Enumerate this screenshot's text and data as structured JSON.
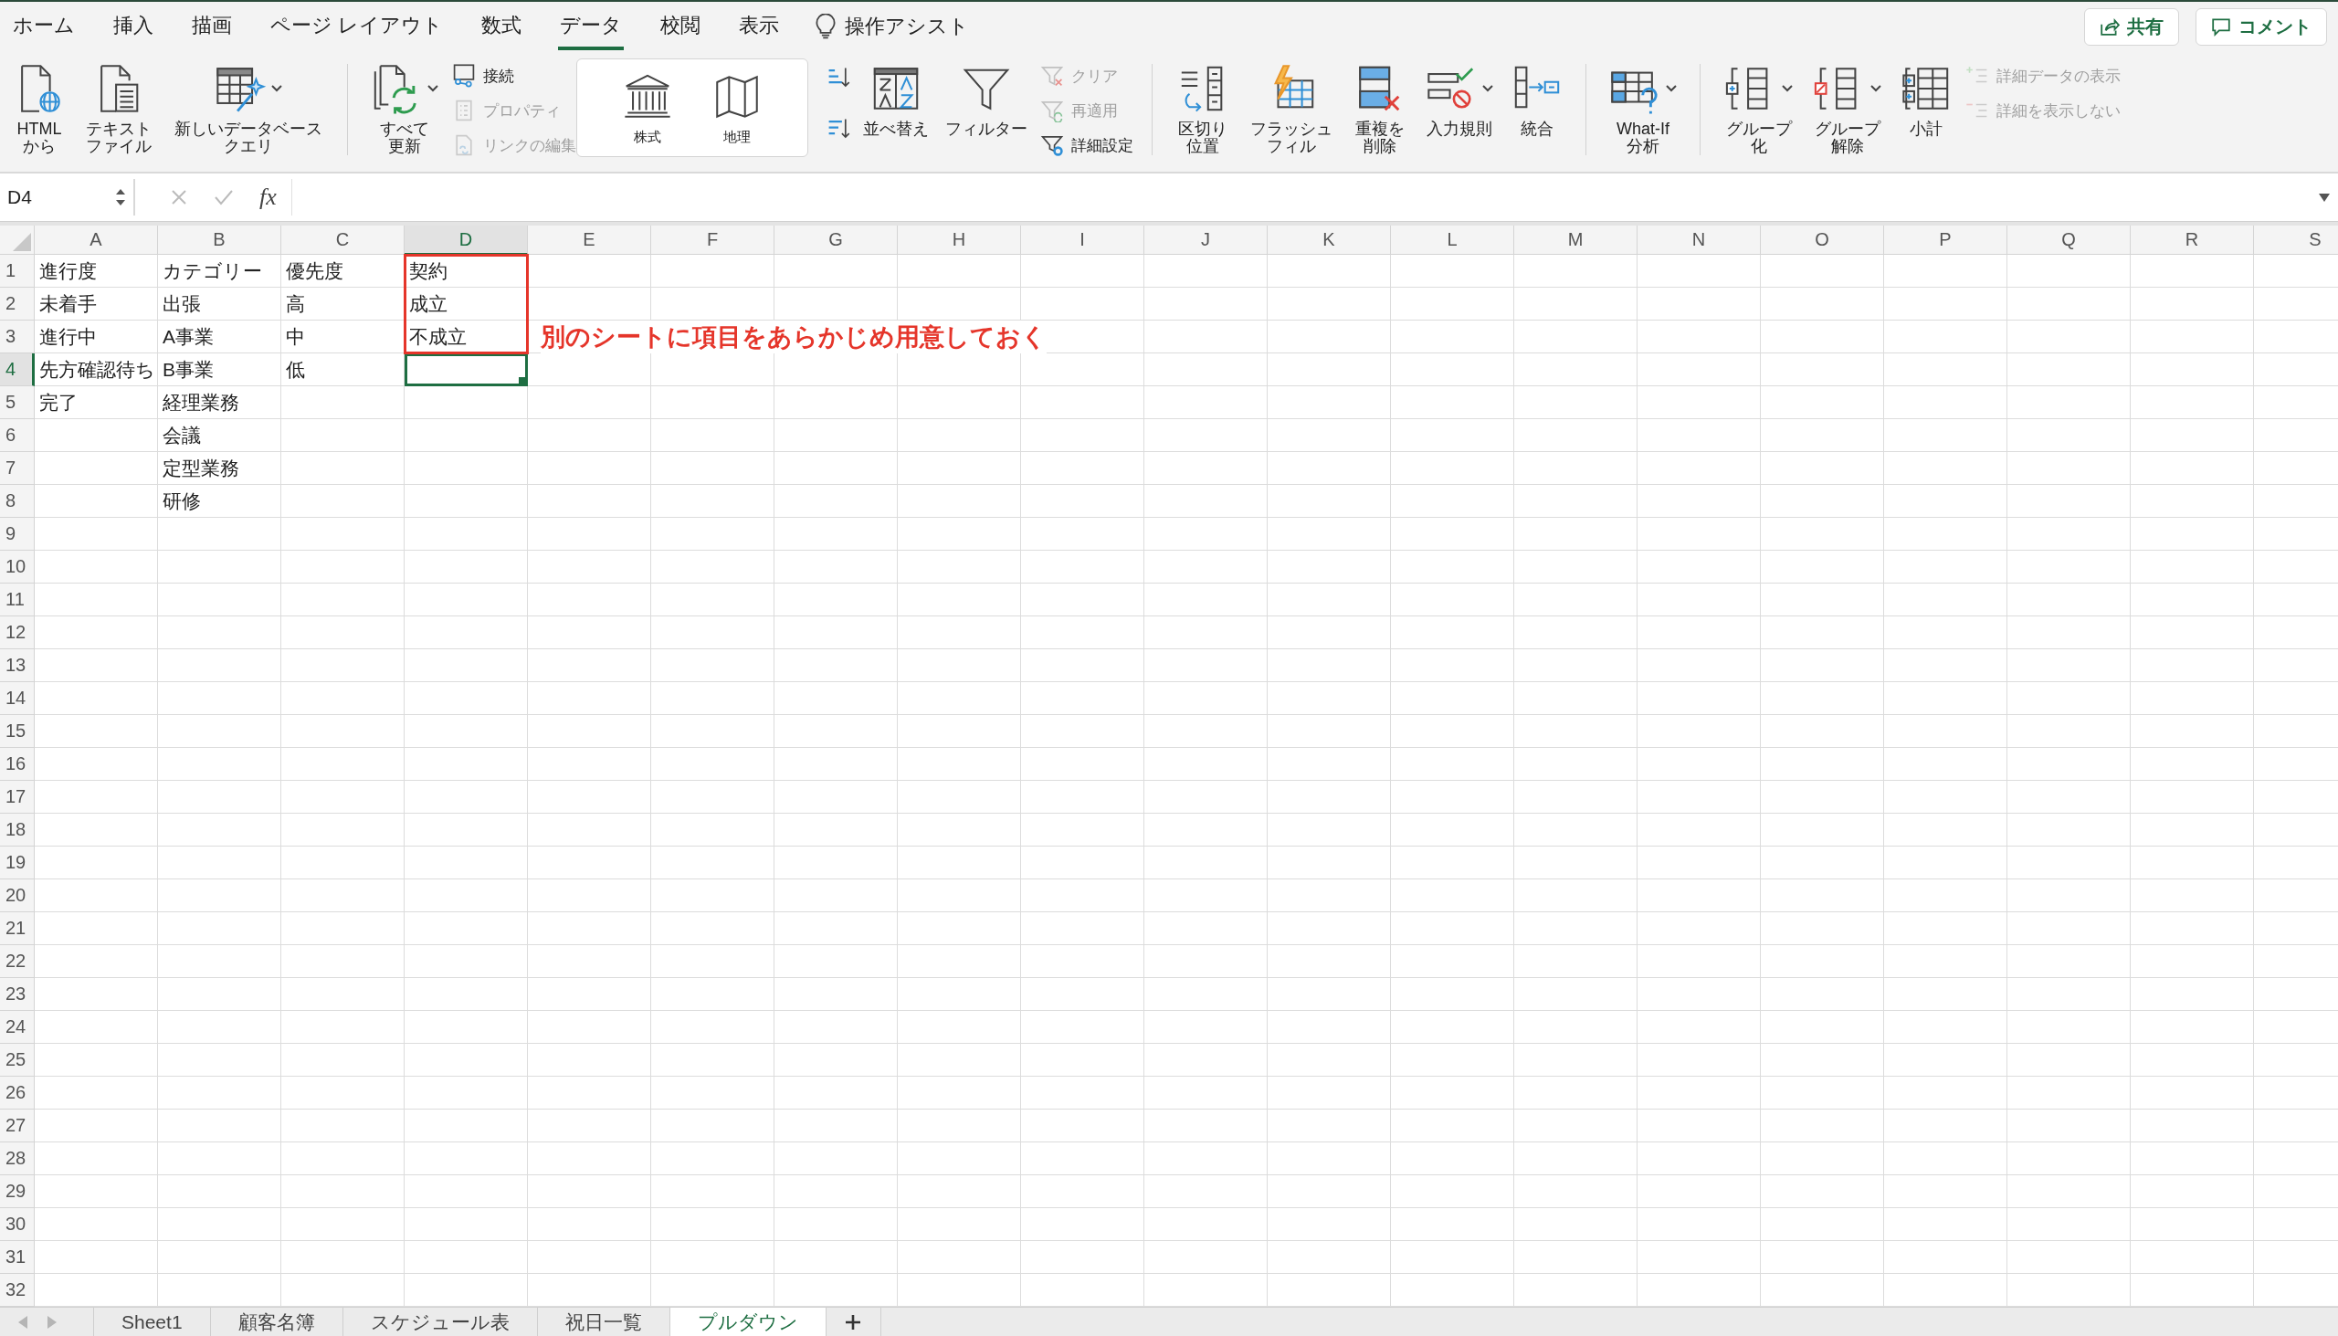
{
  "menu_tabs": [
    {
      "label": "ホーム",
      "selected": false
    },
    {
      "label": "挿入",
      "selected": false
    },
    {
      "label": "描画",
      "selected": false
    },
    {
      "label": "ページ レイアウト",
      "selected": false
    },
    {
      "label": "数式",
      "selected": false
    },
    {
      "label": "データ",
      "selected": true
    },
    {
      "label": "校閲",
      "selected": false
    },
    {
      "label": "表示",
      "selected": false
    }
  ],
  "tell_me": {
    "label": "操作アシスト"
  },
  "actions": [
    {
      "label": "共有"
    },
    {
      "label": "コメント"
    }
  ],
  "ribbon": [
    {
      "kind": "buttons",
      "columns": [
        [
          {
            "kind": "large",
            "label": "HTML\nから",
            "caret": false,
            "disabled": false
          }
        ],
        [
          {
            "kind": "large",
            "label": "テキストファイル",
            "caret": false,
            "disabled": false
          }
        ],
        [
          {
            "kind": "large",
            "label": "新しいデータベースクエリ",
            "caret": true,
            "disabled": false
          }
        ]
      ]
    },
    {
      "kind": "buttons",
      "columns": [
        [
          {
            "kind": "large",
            "label": "すべて更新",
            "caret": true,
            "disabled": false
          }
        ],
        [
          {
            "kind": "small",
            "label": "接続",
            "disabled": false
          },
          {
            "kind": "small",
            "label": "プロパティ",
            "disabled": true
          },
          {
            "kind": "small",
            "label": "リンクの編集",
            "disabled": true
          }
        ]
      ]
    },
    {
      "kind": "gallery",
      "columns": [
        [
          {
            "kind": "gallery",
            "label": "株式",
            "disabled": false
          }
        ],
        [
          {
            "kind": "gallery",
            "label": "地理",
            "disabled": false
          }
        ]
      ]
    },
    {
      "kind": "buttons",
      "columns": [
        [
          {
            "kind": "icon",
            "disabled": false
          },
          {
            "kind": "icon",
            "disabled": false
          }
        ],
        [
          {
            "kind": "large",
            "label": "並べ替え",
            "caret": false,
            "disabled": false
          }
        ],
        [
          {
            "kind": "large",
            "label": "フィルター",
            "caret": false,
            "disabled": false
          }
        ],
        [
          {
            "kind": "small",
            "label": "クリア",
            "disabled": true
          },
          {
            "kind": "small",
            "label": "再適用",
            "disabled": true
          },
          {
            "kind": "small",
            "label": "詳細設定",
            "disabled": false
          }
        ]
      ]
    },
    {
      "kind": "buttons",
      "columns": [
        [
          {
            "kind": "large",
            "label": "区切り位置",
            "caret": false,
            "disabled": false
          }
        ],
        [
          {
            "kind": "large",
            "label": "フラッシュフィル",
            "caret": false,
            "disabled": false
          }
        ],
        [
          {
            "kind": "large",
            "label": "重複を削除",
            "caret": false,
            "disabled": false
          }
        ],
        [
          {
            "kind": "large",
            "label": "入力規則",
            "caret": true,
            "disabled": false
          }
        ],
        [
          {
            "kind": "large",
            "label": "統合",
            "caret": false,
            "disabled": false
          }
        ]
      ]
    },
    {
      "kind": "buttons",
      "columns": [
        [
          {
            "kind": "large",
            "label": "What-If\n分析",
            "caret": true,
            "disabled": false
          }
        ]
      ]
    },
    {
      "kind": "buttons",
      "columns": [
        [
          {
            "kind": "large",
            "label": "グループ化",
            "caret": true,
            "disabled": false
          }
        ],
        [
          {
            "kind": "large",
            "label": "グループ解除",
            "caret": true,
            "disabled": false
          }
        ],
        [
          {
            "kind": "large",
            "label": "小計",
            "caret": false,
            "disabled": false
          }
        ],
        [
          {
            "kind": "small",
            "label": "詳細データの表示",
            "disabled": true
          },
          {
            "kind": "small",
            "label": "詳細を表示しない",
            "disabled": true
          }
        ]
      ]
    }
  ],
  "formula_bar": {
    "name_box": "D4",
    "function_label": "fx"
  },
  "columns": [
    {
      "label": "A",
      "selected": false,
      "boxed": false,
      "cells": [
        "進行度",
        "未着手",
        "進行中",
        "先方確認待ち",
        "完了"
      ]
    },
    {
      "label": "B",
      "selected": false,
      "boxed": false,
      "cells": [
        "カテゴリー",
        "出張",
        "A事業",
        "B事業",
        "経理業務",
        "会議",
        "定型業務",
        "研修"
      ]
    },
    {
      "label": "C",
      "selected": false,
      "boxed": false,
      "cells": [
        "優先度",
        "高",
        "中",
        "低"
      ]
    },
    {
      "label": "D",
      "selected": true,
      "boxed": true,
      "cells": [
        "契約",
        "成立",
        "不成立"
      ],
      "note": "別のシートに項目をあらかじめ用意しておく"
    },
    {
      "label": "E",
      "selected": false,
      "boxed": false
    },
    {
      "label": "F",
      "selected": false,
      "boxed": false
    },
    {
      "label": "G",
      "selected": false,
      "boxed": false
    },
    {
      "label": "H",
      "selected": false,
      "boxed": false
    },
    {
      "label": "I",
      "selected": false,
      "boxed": false
    },
    {
      "label": "J",
      "selected": false,
      "boxed": false
    },
    {
      "label": "K",
      "selected": false,
      "boxed": false
    },
    {
      "label": "L",
      "selected": false,
      "boxed": false
    },
    {
      "label": "M",
      "selected": false,
      "boxed": false
    },
    {
      "label": "N",
      "selected": false,
      "boxed": false
    },
    {
      "label": "O",
      "selected": false,
      "boxed": false
    },
    {
      "label": "P",
      "selected": false,
      "boxed": false
    },
    {
      "label": "Q",
      "selected": false,
      "boxed": false
    },
    {
      "label": "R",
      "selected": false,
      "boxed": false
    },
    {
      "label": "S",
      "selected": false,
      "boxed": false
    }
  ],
  "rows": [
    {
      "number": "1",
      "selected": false
    },
    {
      "number": "2",
      "selected": false
    },
    {
      "number": "3",
      "selected": false
    },
    {
      "number": "4",
      "selected": true
    },
    {
      "number": "5",
      "selected": false
    },
    {
      "number": "6",
      "selected": false
    },
    {
      "number": "7",
      "selected": false
    },
    {
      "number": "8",
      "selected": false
    },
    {
      "number": "9",
      "selected": false
    },
    {
      "number": "10",
      "selected": false
    },
    {
      "number": "11",
      "selected": false
    },
    {
      "number": "12",
      "selected": false
    },
    {
      "number": "13",
      "selected": false
    },
    {
      "number": "14",
      "selected": false
    },
    {
      "number": "15",
      "selected": false
    },
    {
      "number": "16",
      "selected": false
    },
    {
      "number": "17",
      "selected": false
    },
    {
      "number": "18",
      "selected": false
    },
    {
      "number": "19",
      "selected": false
    },
    {
      "number": "20",
      "selected": false
    },
    {
      "number": "21",
      "selected": false
    },
    {
      "number": "22",
      "selected": false
    },
    {
      "number": "23",
      "selected": false
    },
    {
      "number": "24",
      "selected": false
    },
    {
      "number": "25",
      "selected": false
    },
    {
      "number": "26",
      "selected": false
    },
    {
      "number": "27",
      "selected": false
    },
    {
      "number": "28",
      "selected": false
    },
    {
      "number": "29",
      "selected": false
    },
    {
      "number": "30",
      "selected": false
    },
    {
      "number": "31",
      "selected": false
    },
    {
      "number": "32",
      "selected": false
    }
  ],
  "sheet_tabs": [
    {
      "label": "Sheet1",
      "selected": false
    },
    {
      "label": "顧客名簿",
      "selected": false
    },
    {
      "label": "スケジュール表",
      "selected": false
    },
    {
      "label": "祝日一覧",
      "selected": false
    },
    {
      "label": "プルダウン",
      "selected": true
    }
  ]
}
